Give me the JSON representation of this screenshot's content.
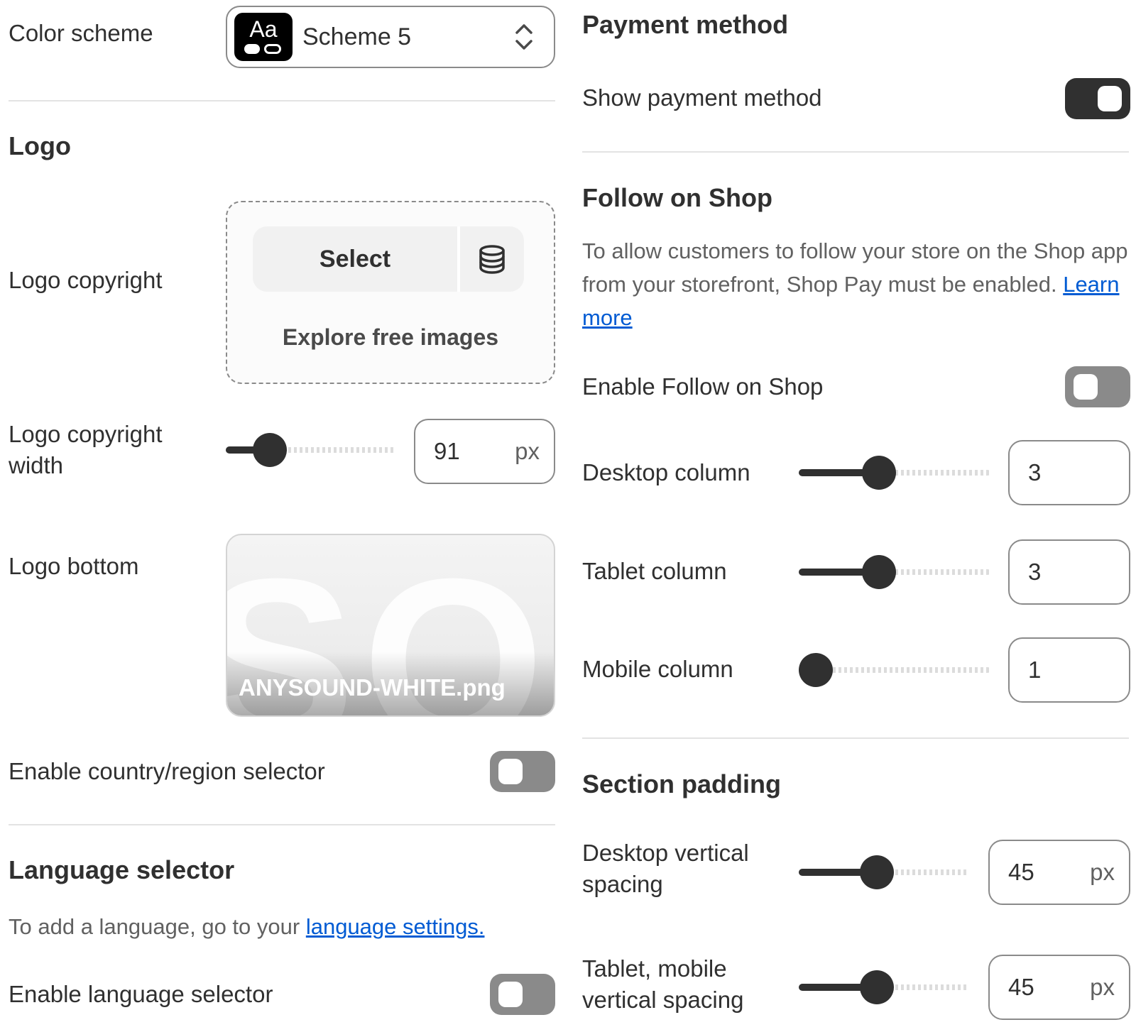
{
  "left": {
    "color_scheme": {
      "label": "Color scheme",
      "swatch_text": "Aa",
      "value": "Scheme 5"
    },
    "logo": {
      "heading": "Logo",
      "copyright_label": "Logo copyright",
      "select_button": "Select",
      "explore_link": "Explore free images",
      "width_label": "Logo copyright width",
      "width_value": "91",
      "width_unit": "px",
      "width_fraction": 0.2,
      "bottom_label": "Logo bottom",
      "bottom_filename": "ANYSOUND-WHITE.png"
    },
    "country_selector": {
      "label": "Enable country/region selector",
      "enabled": false
    },
    "language": {
      "heading": "Language selector",
      "help_text": "To add a language, go to your ",
      "help_link": "language settings.",
      "toggle_label": "Enable language selector",
      "enabled": false
    }
  },
  "right": {
    "payment": {
      "heading": "Payment method",
      "toggle_label": "Show payment method",
      "enabled": true
    },
    "follow": {
      "heading": "Follow on Shop",
      "help_text": "To allow customers to follow your store on the Shop app from your storefront, Shop Pay must be enabled.",
      "help_link": "Learn more",
      "toggle_label": "Enable Follow on Shop",
      "enabled": false,
      "desktop_label": "Desktop column",
      "desktop_value": "3",
      "tablet_label": "Tablet column",
      "tablet_value": "3",
      "mobile_label": "Mobile column",
      "mobile_value": "1"
    },
    "padding": {
      "heading": "Section padding",
      "desktop_label": "Desktop vertical spacing",
      "desktop_value": "45",
      "tablet_label": "Tablet, mobile vertical spacing",
      "tablet_value": "45",
      "unit": "px"
    }
  },
  "colors": {
    "dark": "#303030",
    "link": "#005bd3",
    "muted": "#616161",
    "toggle_off": "#8a8a8a"
  },
  "icons": [
    "chevron-up-down-icon",
    "database-icon"
  ]
}
